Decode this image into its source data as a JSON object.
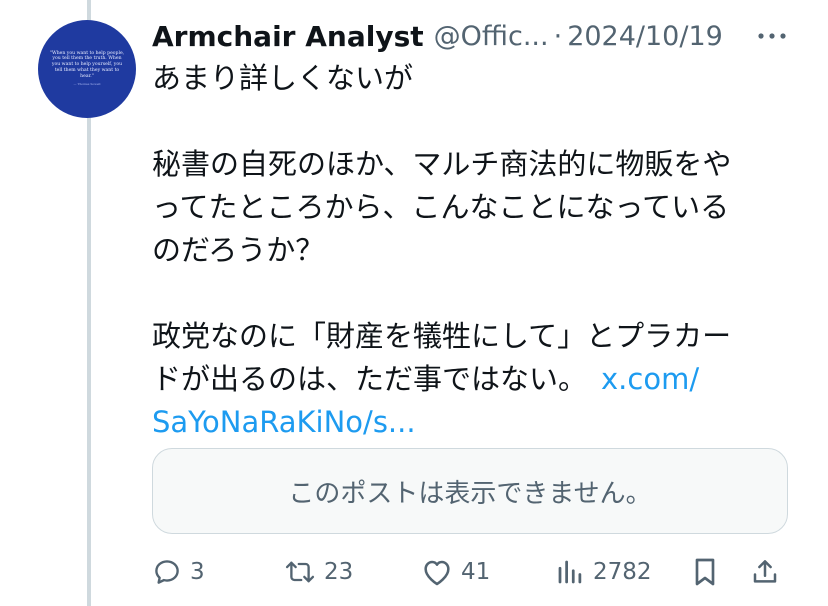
{
  "tweet": {
    "author_name": "Armchair Analyst",
    "handle": "@Offic...",
    "separator": "·",
    "date": "2024/10/19",
    "avatar_text": "\"When you want to help people, you tell them the truth. When you want to help yourself, you tell them what they want to hear.\"",
    "avatar_attribution": "— Thomas Sowell",
    "text_paragraphs": [
      [
        "あまり詳しくないが"
      ],
      [
        "秘書の自死のほか、マルチ商法的に物販をや",
        "ってたところから、こんなことになっている",
        "のだろうか？"
      ],
      [
        "政党なのに「財産を犠牲にして」とプラカー",
        "ドが出るのは、ただ事ではない。"
      ]
    ],
    "link_part1": "x.com/",
    "link_part2": "SaYoNaRaKiNo/s...",
    "quote_unavailable": "このポストは表示できません。"
  },
  "actions": {
    "replies": "3",
    "reposts": "23",
    "likes": "41",
    "views": "2782"
  },
  "icons": [
    "more-icon",
    "reply-icon",
    "repost-icon",
    "like-icon",
    "views-icon",
    "bookmark-icon",
    "share-icon"
  ],
  "colors": {
    "text_primary": "#0f1419",
    "text_secondary": "#536471",
    "link": "#1d9bf0",
    "avatar_background": "#1f3aa0",
    "thread_line": "#cfd9de",
    "card_border": "#cfd9de",
    "card_background": "#f7f9f9"
  }
}
